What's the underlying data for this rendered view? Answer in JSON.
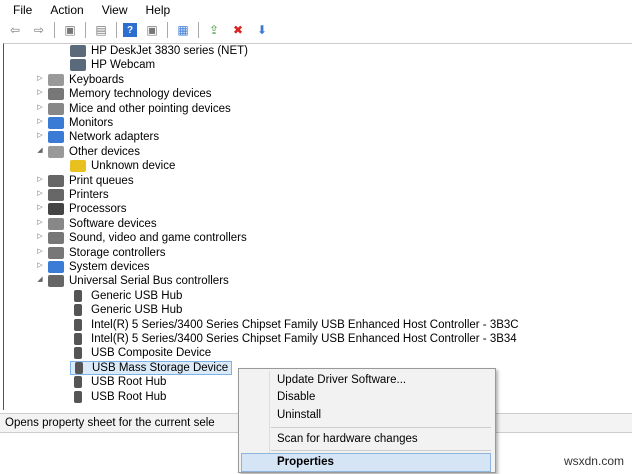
{
  "menu": [
    "File",
    "Action",
    "View",
    "Help"
  ],
  "tree": [
    {
      "label": "HP DeskJet 3830 series (NET)",
      "level": 1,
      "arrow": "",
      "color": "#5a6a7a"
    },
    {
      "label": "HP Webcam",
      "level": 1,
      "arrow": "",
      "color": "#5a6a7a"
    },
    {
      "label": "Keyboards",
      "level": 0,
      "arrow": "▷",
      "color": "#999"
    },
    {
      "label": "Memory technology devices",
      "level": 0,
      "arrow": "▷",
      "color": "#777"
    },
    {
      "label": "Mice and other pointing devices",
      "level": 0,
      "arrow": "▷",
      "color": "#888"
    },
    {
      "label": "Monitors",
      "level": 0,
      "arrow": "▷",
      "color": "#3a7bd5"
    },
    {
      "label": "Network adapters",
      "level": 0,
      "arrow": "▷",
      "color": "#3a7bd5"
    },
    {
      "label": "Other devices",
      "level": 0,
      "arrow": "◢",
      "color": "#999"
    },
    {
      "label": "Unknown device",
      "level": 1,
      "arrow": "",
      "color": "#e8c020"
    },
    {
      "label": "Print queues",
      "level": 0,
      "arrow": "▷",
      "color": "#666"
    },
    {
      "label": "Printers",
      "level": 0,
      "arrow": "▷",
      "color": "#666"
    },
    {
      "label": "Processors",
      "level": 0,
      "arrow": "▷",
      "color": "#444"
    },
    {
      "label": "Software devices",
      "level": 0,
      "arrow": "▷",
      "color": "#888"
    },
    {
      "label": "Sound, video and game controllers",
      "level": 0,
      "arrow": "▷",
      "color": "#777"
    },
    {
      "label": "Storage controllers",
      "level": 0,
      "arrow": "▷",
      "color": "#777"
    },
    {
      "label": "System devices",
      "level": 0,
      "arrow": "▷",
      "color": "#3a7bd5"
    },
    {
      "label": "Universal Serial Bus controllers",
      "level": 0,
      "arrow": "◢",
      "color": "#666"
    },
    {
      "label": "Generic USB Hub",
      "level": 1,
      "arrow": "",
      "color": "#555"
    },
    {
      "label": "Generic USB Hub",
      "level": 1,
      "arrow": "",
      "color": "#555"
    },
    {
      "label": "Intel(R) 5 Series/3400 Series Chipset Family USB Enhanced Host Controller - 3B3C",
      "level": 1,
      "arrow": "",
      "color": "#555"
    },
    {
      "label": "Intel(R) 5 Series/3400 Series Chipset Family USB Enhanced Host Controller - 3B34",
      "level": 1,
      "arrow": "",
      "color": "#555"
    },
    {
      "label": "USB Composite Device",
      "level": 1,
      "arrow": "",
      "color": "#555"
    },
    {
      "label": "USB Mass Storage Device",
      "level": 1,
      "arrow": "",
      "color": "#555",
      "selected": true
    },
    {
      "label": "USB Root Hub",
      "level": 1,
      "arrow": "",
      "color": "#555"
    },
    {
      "label": "USB Root Hub",
      "level": 1,
      "arrow": "",
      "color": "#555"
    }
  ],
  "status": "Opens property sheet for the current sele",
  "context_menu": {
    "update": "Update Driver Software...",
    "disable": "Disable",
    "uninstall": "Uninstall",
    "scan": "Scan for hardware changes",
    "properties": "Properties"
  },
  "watermark": "wsxdn.com"
}
